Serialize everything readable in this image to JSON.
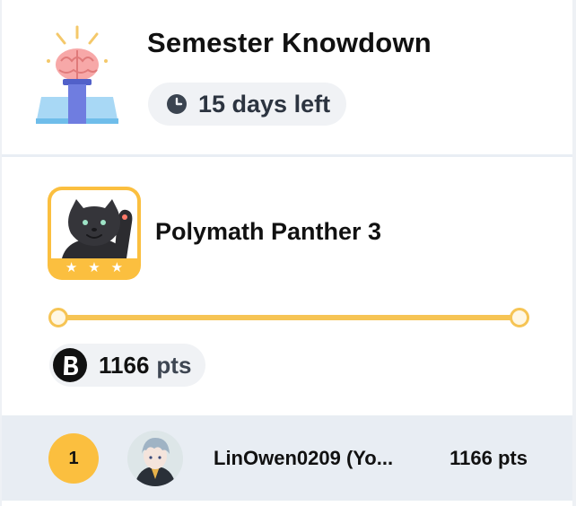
{
  "event": {
    "title": "Semester Knowdown",
    "days_left": "15 days left"
  },
  "level": {
    "name": "Polymath Panther 3",
    "stars": [
      "★",
      "★",
      "★"
    ],
    "progress_fraction": 1.0
  },
  "points": {
    "value": "1166",
    "unit": "pts"
  },
  "leaderboard": {
    "rows": [
      {
        "rank": "1",
        "name": "LinOwen0209 (Yo...",
        "points": "1166 pts"
      }
    ]
  },
  "colors": {
    "accent_gold": "#fbbf3f",
    "progress": "#f6c454",
    "row_highlight": "#e8edf3",
    "pill_bg": "#f0f2f5"
  },
  "icons": {
    "trophy": "brain-trophy-icon",
    "clock": "clock-icon",
    "coin": "b-coin-icon",
    "badge": "panther-badge-icon"
  }
}
